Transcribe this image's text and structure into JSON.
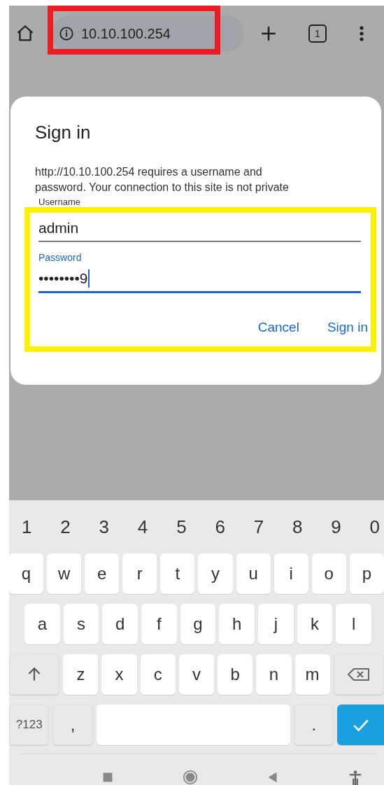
{
  "browser": {
    "address": "10.10.100.254",
    "tab_count": "1"
  },
  "dialog": {
    "title": "Sign in",
    "message": "http://10.10.100.254 requires a username and password. Your connection to this site is not private",
    "fields": [
      {
        "label": "Username",
        "value": "admin",
        "focused": false
      },
      {
        "label": "Password",
        "value": "••••••••9",
        "focused": true
      }
    ],
    "buttons": [
      "Cancel",
      "Sign in"
    ]
  },
  "keyboard": {
    "number_row": [
      "1",
      "2",
      "3",
      "4",
      "5",
      "6",
      "7",
      "8",
      "9",
      "0"
    ],
    "top_row": [
      {
        "kind": "letter",
        "label": "q"
      },
      {
        "kind": "letter",
        "label": "w"
      },
      {
        "kind": "letter",
        "label": "e"
      },
      {
        "kind": "letter",
        "label": "r"
      },
      {
        "kind": "letter",
        "label": "t"
      },
      {
        "kind": "letter",
        "label": "y"
      },
      {
        "kind": "letter",
        "label": "u"
      },
      {
        "kind": "letter",
        "label": "i"
      },
      {
        "kind": "letter",
        "label": "o"
      },
      {
        "kind": "letter",
        "label": "p"
      }
    ],
    "home_row": [
      {
        "kind": "letter",
        "label": "a"
      },
      {
        "kind": "letter",
        "label": "s"
      },
      {
        "kind": "letter",
        "label": "d"
      },
      {
        "kind": "letter",
        "label": "f"
      },
      {
        "kind": "letter",
        "label": "g"
      },
      {
        "kind": "letter",
        "label": "h"
      },
      {
        "kind": "letter",
        "label": "j"
      },
      {
        "kind": "letter",
        "label": "k"
      },
      {
        "kind": "letter",
        "label": "l"
      }
    ],
    "bottom_row": [
      {
        "kind": "shift"
      },
      {
        "kind": "letter",
        "label": "z"
      },
      {
        "kind": "letter",
        "label": "x"
      },
      {
        "kind": "letter",
        "label": "c"
      },
      {
        "kind": "letter",
        "label": "v"
      },
      {
        "kind": "letter",
        "label": "b"
      },
      {
        "kind": "letter",
        "label": "n"
      },
      {
        "kind": "letter",
        "label": "m"
      },
      {
        "kind": "backspace"
      }
    ],
    "function_row": [
      {
        "kind": "symbol",
        "label": "?123"
      },
      {
        "kind": "symbol",
        "label": ","
      },
      {
        "kind": "space"
      },
      {
        "kind": "symbol",
        "label": "."
      },
      {
        "kind": "enter"
      }
    ]
  }
}
